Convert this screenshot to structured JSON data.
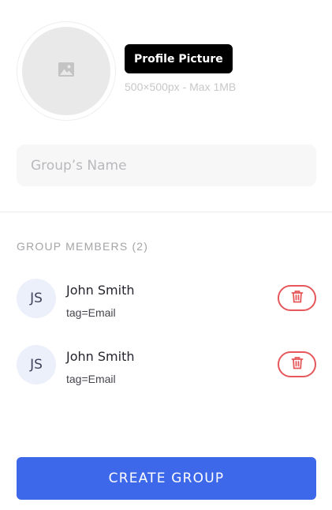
{
  "profile": {
    "button_label": "Profile Picture",
    "hint": "500×500px - Max 1MB",
    "icon": "image-placeholder-icon"
  },
  "group_name": {
    "placeholder": "Group’s Name",
    "value": ""
  },
  "members": {
    "title": "GROUP MEMBERS (2)",
    "items": [
      {
        "initials": "JS",
        "name": "John Smith",
        "tag": "tag=Email"
      },
      {
        "initials": "JS",
        "name": "John Smith",
        "tag": "tag=Email"
      }
    ],
    "delete_icon": "trash-icon"
  },
  "create_button": {
    "label": "CREATE GROUP"
  },
  "colors": {
    "primary": "#3d68e9",
    "danger": "#e5575a",
    "avatar_bg": "#ebf0fb"
  }
}
